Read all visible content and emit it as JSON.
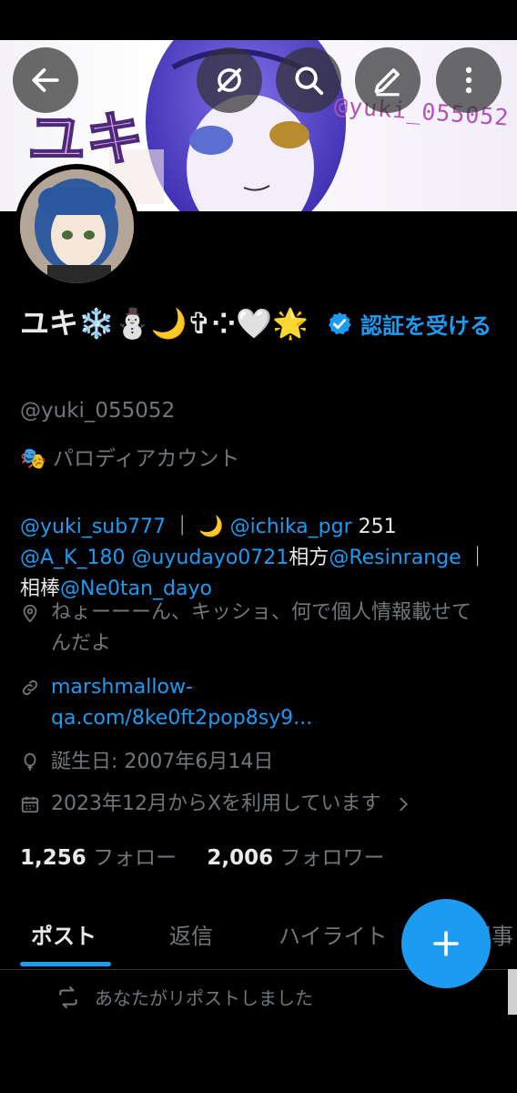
{
  "profile": {
    "name": "ユキ❄️⛄🌙✞⁘🤍🌟",
    "verify_link": "認証を受ける",
    "handle": "@yuki_055052",
    "parody_label": "🎭 パロディアカウント",
    "bio": {
      "mention1": "@yuki_sub777",
      "sep1": " ｜ 🌙 ",
      "mention2": "@ichika_pgr",
      "num": " 251 ",
      "mention3": "@A_K_180",
      "space": " ",
      "mention4": "@uyudayo0721",
      "partner_label": "相方",
      "mention5": "@Resinrange",
      "sep2": " ｜相棒",
      "mention6": "@Ne0tan_dayo"
    },
    "location": "ねょーーーん、キッショ、何で個人情報載せてんだよ",
    "website": "marshmallow-qa.com/8ke0ft2pop8sy9...",
    "birthday": "誕生日: 2007年6月14日",
    "joined": "2023年12月からXを利用しています",
    "following_count": "1,256",
    "following_label": "フォロー",
    "followers_count": "2,006",
    "followers_label": "フォロワー"
  },
  "banner": {
    "title_text": "ユキ",
    "handle_text": "@yuki_055052"
  },
  "tabs": [
    {
      "label": "ポスト",
      "active": true
    },
    {
      "label": "返信",
      "active": false
    },
    {
      "label": "ハイライト",
      "active": false
    },
    {
      "label": "記事",
      "active": false
    }
  ],
  "feed": {
    "repost_label": "あなたがリポストしました"
  },
  "icons": {
    "back": "back-arrow-icon",
    "grok": "grok-icon",
    "search": "search-icon",
    "edit": "edit-icon",
    "more": "more-icon",
    "location": "location-icon",
    "link": "link-icon",
    "birthday": "balloon-icon",
    "calendar": "calendar-icon",
    "compose": "plus-icon",
    "repost": "repost-icon"
  },
  "colors": {
    "accent": "#1d9bf0",
    "background": "#000000",
    "muted_text": "#71767b",
    "primary_text": "#e7e9ea"
  }
}
